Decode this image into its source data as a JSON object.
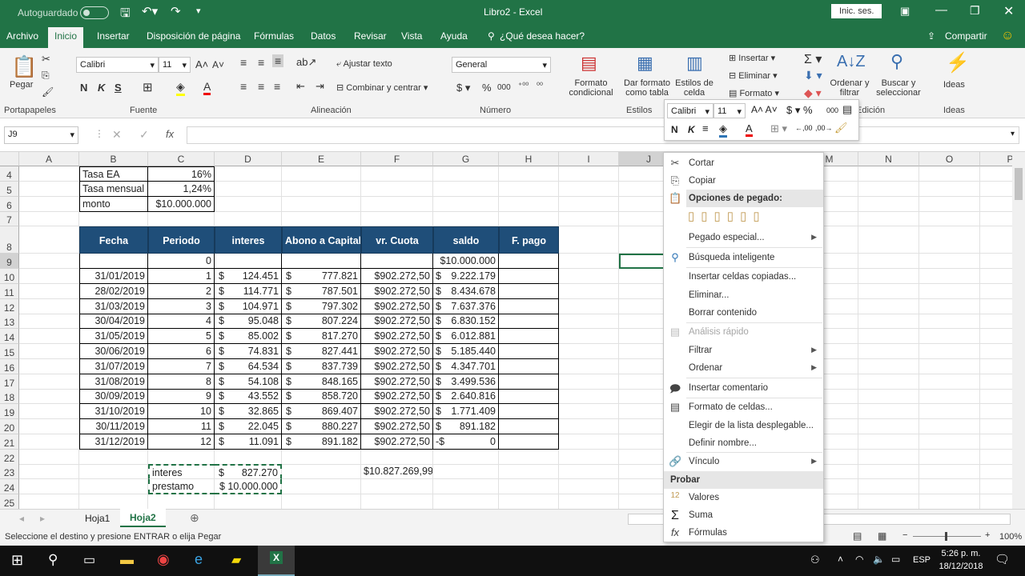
{
  "titlebar": {
    "autosave": "Autoguardado",
    "doc_title": "Libro2 - Excel",
    "signin": "Inic. ses."
  },
  "ribbon_tabs": [
    "Archivo",
    "Inicio",
    "Insertar",
    "Disposición de página",
    "Fórmulas",
    "Datos",
    "Revisar",
    "Vista",
    "Ayuda"
  ],
  "tellme": "¿Qué desea hacer?",
  "share": "Compartir",
  "ribbon": {
    "paste": "Pegar",
    "font_name": "Calibri",
    "font_size": "11",
    "wrap": "Ajustar texto",
    "merge": "Combinar y centrar",
    "number_format": "General",
    "cond_format": "Formato condicional",
    "as_table": "Dar formato como tabla",
    "cell_styles": "Estilos de celda",
    "insert": "Insertar",
    "delete": "Eliminar",
    "format": "Formato",
    "sort": "Ordenar y filtrar",
    "find": "Buscar y seleccionar",
    "ideas": "Ideas",
    "bold": "N",
    "italic": "K",
    "underline": "S",
    "groups": [
      "Portapapeles",
      "Fuente",
      "Alineación",
      "Número",
      "Estilos",
      "Edición",
      "Ideas"
    ]
  },
  "formula_bar": {
    "name_box": "J9",
    "value": ""
  },
  "columns": [
    "A",
    "B",
    "C",
    "D",
    "E",
    "F",
    "G",
    "H",
    "I",
    "J",
    "K",
    "L",
    "M",
    "N",
    "O",
    "P"
  ],
  "top_rows": [
    {
      "row": "4",
      "label": "Tasa EA",
      "value": "16%"
    },
    {
      "row": "5",
      "label": "Tasa mensual",
      "value": "1,24%"
    },
    {
      "row": "6",
      "label": "monto",
      "value": "$10.000.000"
    }
  ],
  "table_headers": [
    "Fecha",
    "Periodo",
    "interes",
    "Abono a Capital",
    "vr. Cuota",
    "saldo",
    "F. pago"
  ],
  "table_rows": [
    {
      "row": "9",
      "fecha": "",
      "periodo": "0",
      "interes": "",
      "abono": "",
      "cuota": "",
      "saldo_prefix": "",
      "saldo": "$10.000.000"
    },
    {
      "row": "10",
      "fecha": "31/01/2019",
      "periodo": "1",
      "interes": "124.451",
      "abono": "777.821",
      "cuota": "$902.272,50",
      "saldo_prefix": "$",
      "saldo": "9.222.179"
    },
    {
      "row": "11",
      "fecha": "28/02/2019",
      "periodo": "2",
      "interes": "114.771",
      "abono": "787.501",
      "cuota": "$902.272,50",
      "saldo_prefix": "$",
      "saldo": "8.434.678"
    },
    {
      "row": "12",
      "fecha": "31/03/2019",
      "periodo": "3",
      "interes": "104.971",
      "abono": "797.302",
      "cuota": "$902.272,50",
      "saldo_prefix": "$",
      "saldo": "7.637.376"
    },
    {
      "row": "13",
      "fecha": "30/04/2019",
      "periodo": "4",
      "interes": "95.048",
      "abono": "807.224",
      "cuota": "$902.272,50",
      "saldo_prefix": "$",
      "saldo": "6.830.152"
    },
    {
      "row": "14",
      "fecha": "31/05/2019",
      "periodo": "5",
      "interes": "85.002",
      "abono": "817.270",
      "cuota": "$902.272,50",
      "saldo_prefix": "$",
      "saldo": "6.012.881"
    },
    {
      "row": "15",
      "fecha": "30/06/2019",
      "periodo": "6",
      "interes": "74.831",
      "abono": "827.441",
      "cuota": "$902.272,50",
      "saldo_prefix": "$",
      "saldo": "5.185.440"
    },
    {
      "row": "16",
      "fecha": "31/07/2019",
      "periodo": "7",
      "interes": "64.534",
      "abono": "837.739",
      "cuota": "$902.272,50",
      "saldo_prefix": "$",
      "saldo": "4.347.701"
    },
    {
      "row": "17",
      "fecha": "31/08/2019",
      "periodo": "8",
      "interes": "54.108",
      "abono": "848.165",
      "cuota": "$902.272,50",
      "saldo_prefix": "$",
      "saldo": "3.499.536"
    },
    {
      "row": "18",
      "fecha": "30/09/2019",
      "periodo": "9",
      "interes": "43.552",
      "abono": "858.720",
      "cuota": "$902.272,50",
      "saldo_prefix": "$",
      "saldo": "2.640.816"
    },
    {
      "row": "19",
      "fecha": "31/10/2019",
      "periodo": "10",
      "interes": "32.865",
      "abono": "869.407",
      "cuota": "$902.272,50",
      "saldo_prefix": "$",
      "saldo": "1.771.409"
    },
    {
      "row": "20",
      "fecha": "30/11/2019",
      "periodo": "11",
      "interes": "22.045",
      "abono": "880.227",
      "cuota": "$902.272,50",
      "saldo_prefix": "$",
      "saldo": "891.182"
    },
    {
      "row": "21",
      "fecha": "31/12/2019",
      "periodo": "12",
      "interes": "11.091",
      "abono": "891.182",
      "cuota": "$902.272,50",
      "saldo_prefix": "-$",
      "saldo": "0"
    }
  ],
  "summary": {
    "interes_label": "interes",
    "interes_value": "827.270",
    "prestamo_label": "prestamo",
    "prestamo_value": "$ 10.000.000",
    "total": "$10.827.269,99",
    "currency": "$"
  },
  "row_numbers_extra": [
    "7",
    "8",
    "22",
    "23",
    "24",
    "25"
  ],
  "sheets": [
    "Hoja1",
    "Hoja2"
  ],
  "active_sheet": "Hoja2",
  "status": {
    "message": "Seleccione el destino y presione ENTRAR o elija Pegar",
    "zoom": "100%"
  },
  "context_menu": {
    "cut": "Cortar",
    "copy": "Copiar",
    "paste_options": "Opciones de pegado:",
    "paste_special": "Pegado especial...",
    "smart_lookup": "Búsqueda inteligente",
    "insert_copied": "Insertar celdas copiadas...",
    "delete": "Eliminar...",
    "clear": "Borrar contenido",
    "quick_analysis": "Análisis rápido",
    "filter": "Filtrar",
    "sort": "Ordenar",
    "insert_comment": "Insertar comentario",
    "format_cells": "Formato de celdas...",
    "pick_list": "Elegir de la lista desplegable...",
    "define_name": "Definir nombre...",
    "link": "Vínculo",
    "try": "Probar",
    "values": "Valores",
    "sum": "Suma",
    "formulas": "Fórmulas"
  },
  "taskbar": {
    "lang": "ESP",
    "time": "5:26 p. m.",
    "date": "18/12/2018",
    "notifications": "1"
  },
  "colors": {
    "excel_green": "#217346",
    "header_blue": "#1f4e79"
  }
}
